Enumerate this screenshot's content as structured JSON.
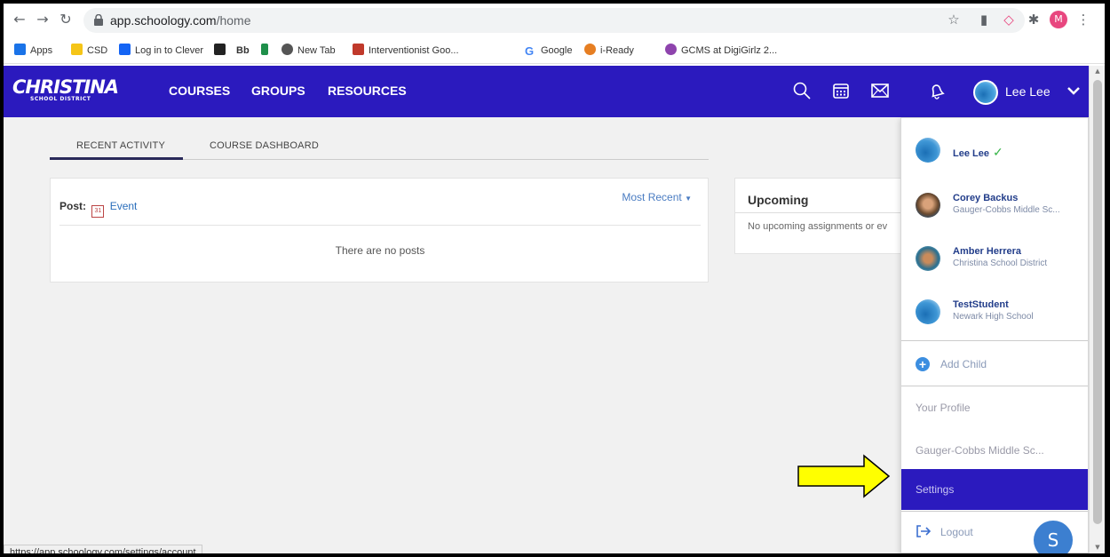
{
  "browser": {
    "url_host": "app.schoology.com",
    "url_path": "/home",
    "profile_initial": "M",
    "bookmarks": [
      {
        "label": "Apps",
        "color": "#1a73e8"
      },
      {
        "label": "CSD",
        "color": "#f5c518"
      },
      {
        "label": "Log in to Clever",
        "color": "#1464f4"
      },
      {
        "label": "",
        "color": "#222222"
      },
      {
        "label": "Bb",
        "color": "#222222"
      },
      {
        "label": "",
        "color": "#1e8f4a"
      },
      {
        "label": "New Tab",
        "color": "#555555"
      },
      {
        "label": "Interventionist Goo...",
        "color": "#c0392b"
      },
      {
        "label": "Google",
        "color": "#4285f4"
      },
      {
        "label": "i-Ready",
        "color": "#e67e22"
      },
      {
        "label": "GCMS at DigiGirlz 2...",
        "color": "#8e44ad"
      }
    ],
    "status_url": "https://app.schoology.com/settings/account"
  },
  "header": {
    "logo_main": "CHRISTINA",
    "logo_sub": "SCHOOL DISTRICT",
    "nav": [
      "COURSES",
      "GROUPS",
      "RESOURCES"
    ],
    "user_name": "Lee Lee",
    "brand_color": "#2b1abe"
  },
  "tabs": [
    "RECENT ACTIVITY",
    "COURSE DASHBOARD"
  ],
  "feed": {
    "post_label": "Post:",
    "event_label": "Event",
    "calendar_day": "31",
    "sort": "Most Recent",
    "empty": "There are no posts"
  },
  "upcoming": {
    "title": "Upcoming",
    "empty": "No upcoming assignments or ev"
  },
  "dropdown": {
    "accounts": [
      {
        "name": "Lee Lee",
        "sub": "",
        "current": true
      },
      {
        "name": "Corey Backus",
        "sub": "Gauger-Cobbs Middle Sc...",
        "current": false
      },
      {
        "name": "Amber Herrera",
        "sub": "Christina School District",
        "current": false
      },
      {
        "name": "TestStudent",
        "sub": "Newark High School",
        "current": false
      }
    ],
    "add_child": "Add Child",
    "your_profile": "Your Profile",
    "school": "Gauger-Cobbs Middle Sc...",
    "settings": "Settings",
    "logout": "Logout",
    "check": "✓"
  },
  "fab_letter": "S"
}
